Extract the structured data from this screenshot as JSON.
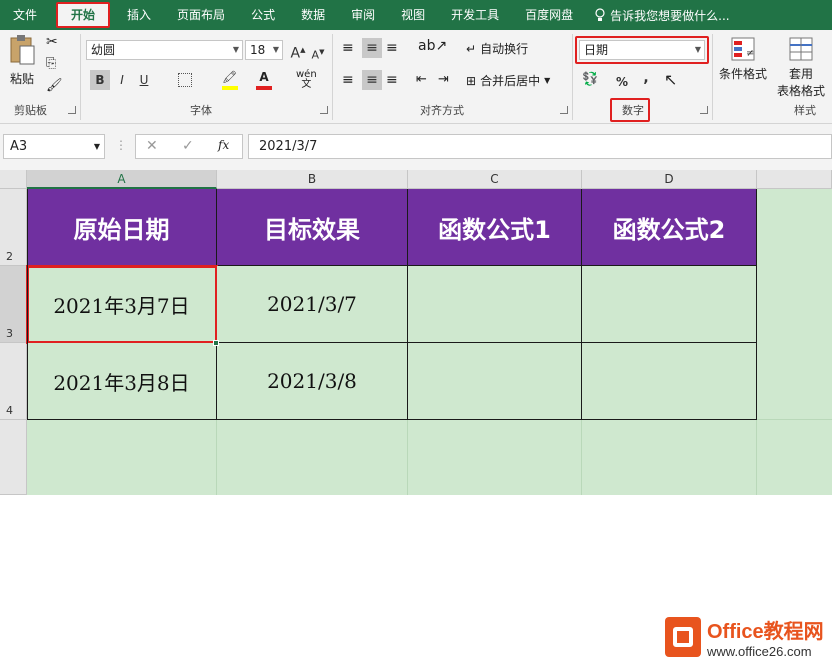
{
  "menubar": {
    "items": [
      "文件",
      "开始",
      "插入",
      "页面布局",
      "公式",
      "数据",
      "审阅",
      "视图",
      "开发工具",
      "百度网盘"
    ],
    "active_index": 1,
    "tell_me": "告诉我您想要做什么..."
  },
  "ribbon": {
    "clipboard": {
      "paste_label": "粘贴",
      "group_label": "剪贴板"
    },
    "font": {
      "font_name": "幼圆",
      "font_size": "18",
      "bold": "B",
      "italic": "I",
      "underline": "U",
      "grow": "A",
      "shrink": "A",
      "wen": "wén",
      "group_label": "字体"
    },
    "alignment": {
      "wrap_text": "自动换行",
      "merge_center": "合并后居中",
      "group_label": "对齐方式"
    },
    "number": {
      "format": "日期",
      "percent": "%",
      "comma": ",",
      "group_label": "数字"
    },
    "styles": {
      "conditional": "条件格式",
      "table_format_1": "套用",
      "table_format_2": "表格格式",
      "group_label": "样式"
    }
  },
  "formula_bar": {
    "name_box": "A3",
    "fx": "fx",
    "value": "2021/3/7"
  },
  "sheet": {
    "columns": [
      "A",
      "B",
      "C",
      "D"
    ],
    "rows": [
      "2",
      "3",
      "4"
    ],
    "header_row": [
      "原始日期",
      "目标效果",
      "函数公式1",
      "函数公式2"
    ],
    "data": [
      [
        "2021年3月7日",
        "2021/3/7",
        "",
        ""
      ],
      [
        "2021年3月8日",
        "2021/3/8",
        "",
        ""
      ]
    ]
  },
  "watermark": {
    "brand": "Office教程网",
    "url": "www.office26.com"
  },
  "colors": {
    "ribbon_green": "#217346",
    "header_purple": "#7030a0",
    "cell_green": "#cfe8cf",
    "highlight_red": "#e02020"
  }
}
